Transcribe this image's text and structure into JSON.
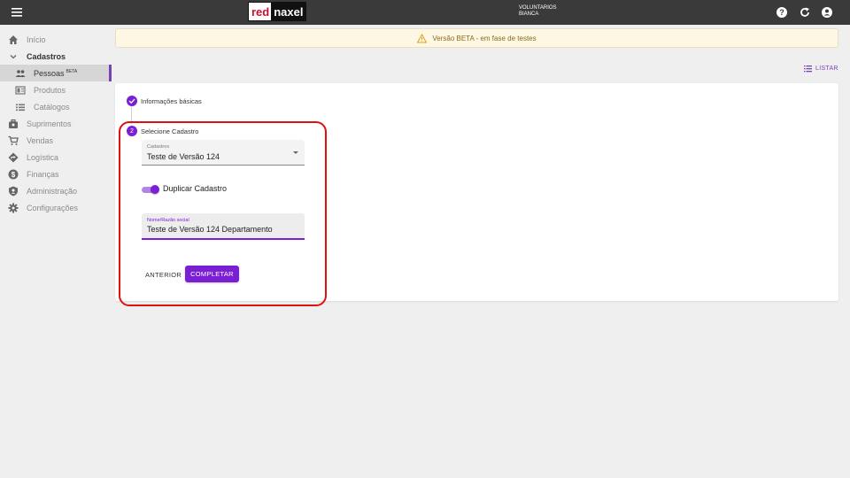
{
  "header": {
    "logo_left": "red",
    "logo_right": "naxel",
    "org": "VOLUNTARIOS",
    "user": "BIANCA",
    "icons": [
      "menu-icon",
      "help-icon",
      "refresh-icon",
      "account-icon"
    ]
  },
  "sidebar": {
    "items": [
      {
        "label": "Início",
        "icon": "home-icon"
      },
      {
        "label": "Cadastros",
        "icon": "chevron-down-icon"
      },
      {
        "label": "Pessoas",
        "badge": "BETA",
        "icon": "people-icon"
      },
      {
        "label": "Produtos",
        "icon": "product-icon"
      },
      {
        "label": "Catálogos",
        "icon": "list-icon"
      },
      {
        "label": "Suprimentos",
        "icon": "supplies-icon"
      },
      {
        "label": "Vendas",
        "icon": "cart-icon"
      },
      {
        "label": "Logística",
        "icon": "route-icon"
      },
      {
        "label": "Finanças",
        "icon": "dollar-icon"
      },
      {
        "label": "Administração",
        "icon": "shield-icon"
      },
      {
        "label": "Configurações",
        "icon": "gear-icon"
      }
    ]
  },
  "banner": {
    "text": "Versão BETA - em fase de testes"
  },
  "actions": {
    "listar": "LISTAR"
  },
  "stepper": {
    "step1_label": "Informações básicas",
    "step2_number": "2",
    "step2_label": "Selecione Cadastro"
  },
  "form": {
    "cadastros_label": "Cadastros",
    "cadastros_value": "Teste de Versão 124",
    "toggle_label": "Duplicar Cadastro",
    "toggle_on": true,
    "nome_label": "Nome/Razão social",
    "nome_value": "Teste de Versão 124 Departamento"
  },
  "buttons": {
    "anterior": "ANTERIOR",
    "completar": "COMPLETAR"
  },
  "colors": {
    "accent": "#7b1fd4",
    "topbar": "#3a3a3a",
    "highlight": "#e01010",
    "banner_bg": "#fdf7e3"
  }
}
